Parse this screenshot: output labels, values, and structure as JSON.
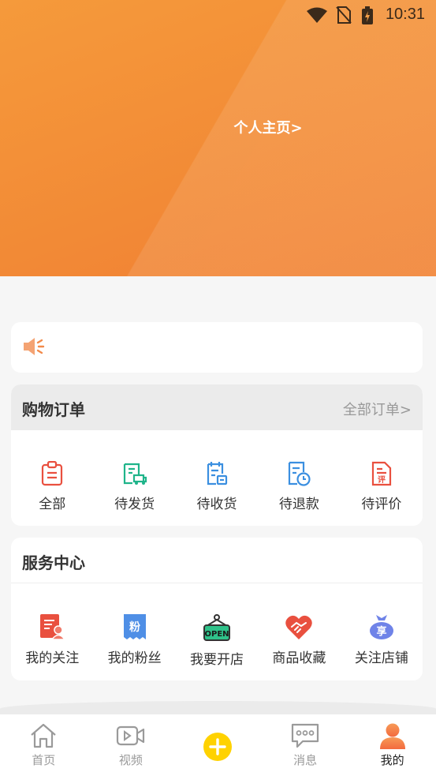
{
  "status_bar": {
    "time": "10:31"
  },
  "header": {
    "profile_link": "个人主页>"
  },
  "orders": {
    "title": "购物订单",
    "more": "全部订单>",
    "items": [
      {
        "label": "全部",
        "icon": "clipboard-icon"
      },
      {
        "label": "待发货",
        "icon": "delivery-truck-icon"
      },
      {
        "label": "待收货",
        "icon": "receive-package-icon"
      },
      {
        "label": "待退款",
        "icon": "refund-clock-icon"
      },
      {
        "label": "待评价",
        "icon": "review-document-icon"
      }
    ]
  },
  "services": {
    "title": "服务中心",
    "items": [
      {
        "label": "我的关注",
        "icon": "follow-icon"
      },
      {
        "label": "我的粉丝",
        "icon": "fans-icon",
        "badge": "粉"
      },
      {
        "label": "我要开店",
        "icon": "open-shop-icon",
        "badge": "OPEN"
      },
      {
        "label": "商品收藏",
        "icon": "heart-handshake-icon"
      },
      {
        "label": "关注店铺",
        "icon": "store-bag-icon",
        "badge": "享"
      }
    ]
  },
  "tabbar": {
    "items": [
      {
        "label": "首页",
        "icon": "home-icon"
      },
      {
        "label": "视频",
        "icon": "video-icon"
      },
      {
        "label": "",
        "icon": "plus-icon"
      },
      {
        "label": "消息",
        "icon": "message-icon"
      },
      {
        "label": "我的",
        "icon": "user-icon",
        "active": true
      }
    ]
  },
  "colors": {
    "header_gradient_start": "#f59a3b",
    "header_gradient_end": "#f07e33",
    "accent_orange": "#f28a36",
    "red_icon": "#e9503f",
    "green_icon": "#1fb48a",
    "blue_icon": "#3b8fe0",
    "plus_yellow": "#ffd200"
  }
}
